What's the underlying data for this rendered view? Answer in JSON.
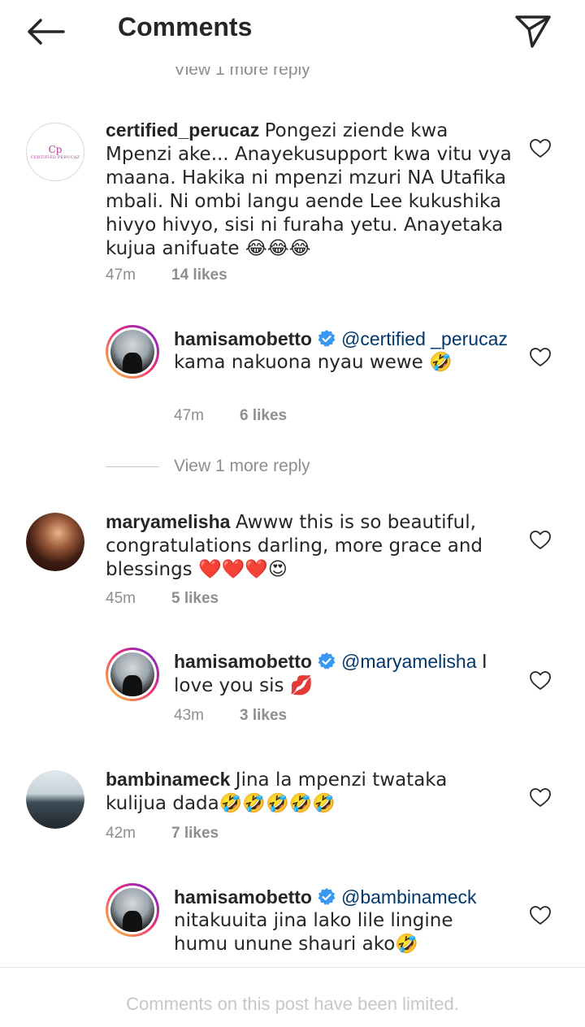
{
  "header": {
    "title": "Comments"
  },
  "clipped_reply": "View 1 more reply",
  "comments": [
    {
      "username": "certified_perucaz",
      "avatar_logo": {
        "glyph": "Cp",
        "word": "CERTIFIED PERUCAZ"
      },
      "text": "Pongezi ziende kwa Mpenzi ake... Anayekusupport kwa vitu vya maana. Hakika ni mpenzi mzuri NA Utafika mbali. Ni ombi langu aende Lee kukushika hivyo hivyo, sisi ni furaha yetu. Anayetaka kujua anifuate 😂😂😂",
      "time": "47m",
      "likes": "14 likes"
    },
    {
      "username": "hamisamobetto",
      "mention": "@certified _perucaz",
      "text": "kama nakuona nyau wewe 🤣",
      "time": "47m",
      "likes": "6 likes"
    },
    {
      "username": "maryamelisha",
      "text": "Awww this is so beautiful, congratulations darling, more grace and blessings ❤️❤️❤️😍",
      "time": "45m",
      "likes": "5 likes"
    },
    {
      "username": "hamisamobetto",
      "mention": "@maryamelisha",
      "text": "I love you sis 💋",
      "time": "43m",
      "likes": "3 likes"
    },
    {
      "username": "bambinameck",
      "text": "Jina la mpenzi twataka kulijua dada🤣🤣🤣🤣🤣",
      "time": "42m",
      "likes": "7 likes"
    },
    {
      "username": "hamisamobetto",
      "mention": "@bambinameck",
      "text": "nitakuuita jina lako lile lingine humu unune shauri ako🤣"
    }
  ],
  "view_more_reply": "View 1 more reply",
  "footer": {
    "text": "Comments on this post have been limited."
  },
  "colors": {
    "verified": "#3897f0",
    "mention": "#00376b",
    "meta": "#8e8e8e",
    "footer_text": "#c7c7c7"
  },
  "icons": {
    "back": "arrow-left",
    "send": "paper-plane",
    "like": "heart-outline",
    "verified": "verified-badge"
  }
}
